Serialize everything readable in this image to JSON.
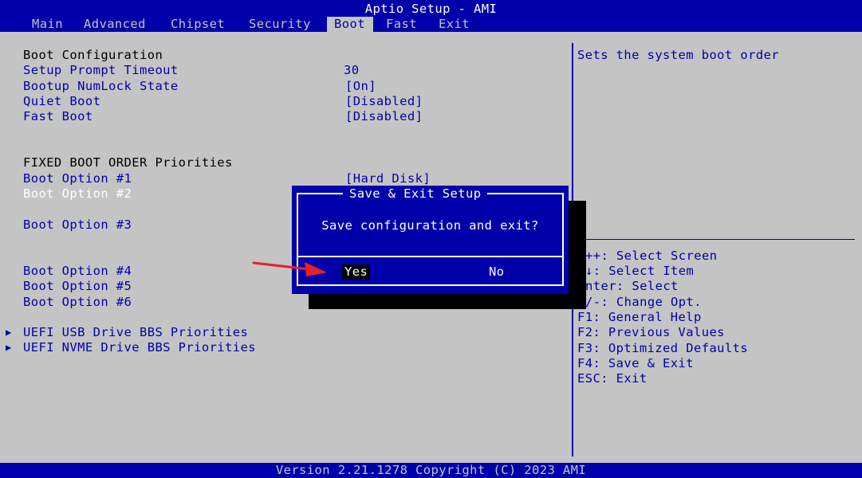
{
  "title": "Aptio Setup - AMI",
  "menu": [
    {
      "label": "Main"
    },
    {
      "label": "Advanced"
    },
    {
      "label": "Chipset"
    },
    {
      "label": "Security"
    },
    {
      "label": "Boot"
    },
    {
      "label": "Fast"
    },
    {
      "label": "Exit"
    }
  ],
  "active_menu": "Boot",
  "settings": {
    "boot_config_header": "Boot Configuration",
    "setup_prompt_timeout": {
      "label": "Setup Prompt Timeout",
      "value": "30"
    },
    "bootup_numlock": {
      "label": "Bootup NumLock State",
      "value": "[On]"
    },
    "quiet_boot": {
      "label": "Quiet Boot",
      "value": "[Disabled]"
    },
    "fast_boot": {
      "label": "Fast Boot",
      "value": "[Disabled]"
    },
    "fixed_order_header": "FIXED BOOT ORDER Priorities",
    "boot_option_1": {
      "label": "Boot Option #1",
      "value": "[Hard Disk]"
    },
    "boot_option_2": {
      "label": "Boot Option #2"
    },
    "boot_option_3": {
      "label": "Boot Option #3"
    },
    "boot_option_4": {
      "label": "Boot Option #4"
    },
    "boot_option_5": {
      "label": "Boot Option #5"
    },
    "boot_option_6": {
      "label": "Boot Option #6"
    },
    "uefi_usb": {
      "label": "UEFI USB Drive BBS Priorities"
    },
    "uefi_nvme": {
      "label": "UEFI NVME Drive BBS Priorities"
    },
    "submenu_marker": "▶"
  },
  "help": {
    "description": "Sets the system boot order",
    "keys": [
      "++: Select Screen",
      "↓: Select Item",
      "nter: Select",
      "/-: Change Opt.",
      "F1: General Help",
      "F2: Previous Values",
      "F3: Optimized Defaults",
      "F4: Save & Exit",
      "ESC: Exit"
    ]
  },
  "dialog": {
    "title": "Save & Exit Setup",
    "message": "Save configuration and exit?",
    "yes_label": "Yes",
    "no_label": "No",
    "selected": "Yes"
  },
  "status": "Version 2.21.1278 Copyright (C) 2023 AMI",
  "colors": {
    "background_blue": "#0000aa",
    "panel_gray": "#c4c4c4",
    "highlight_white": "#ffffff",
    "annotation_arrow": "#e8202a"
  }
}
